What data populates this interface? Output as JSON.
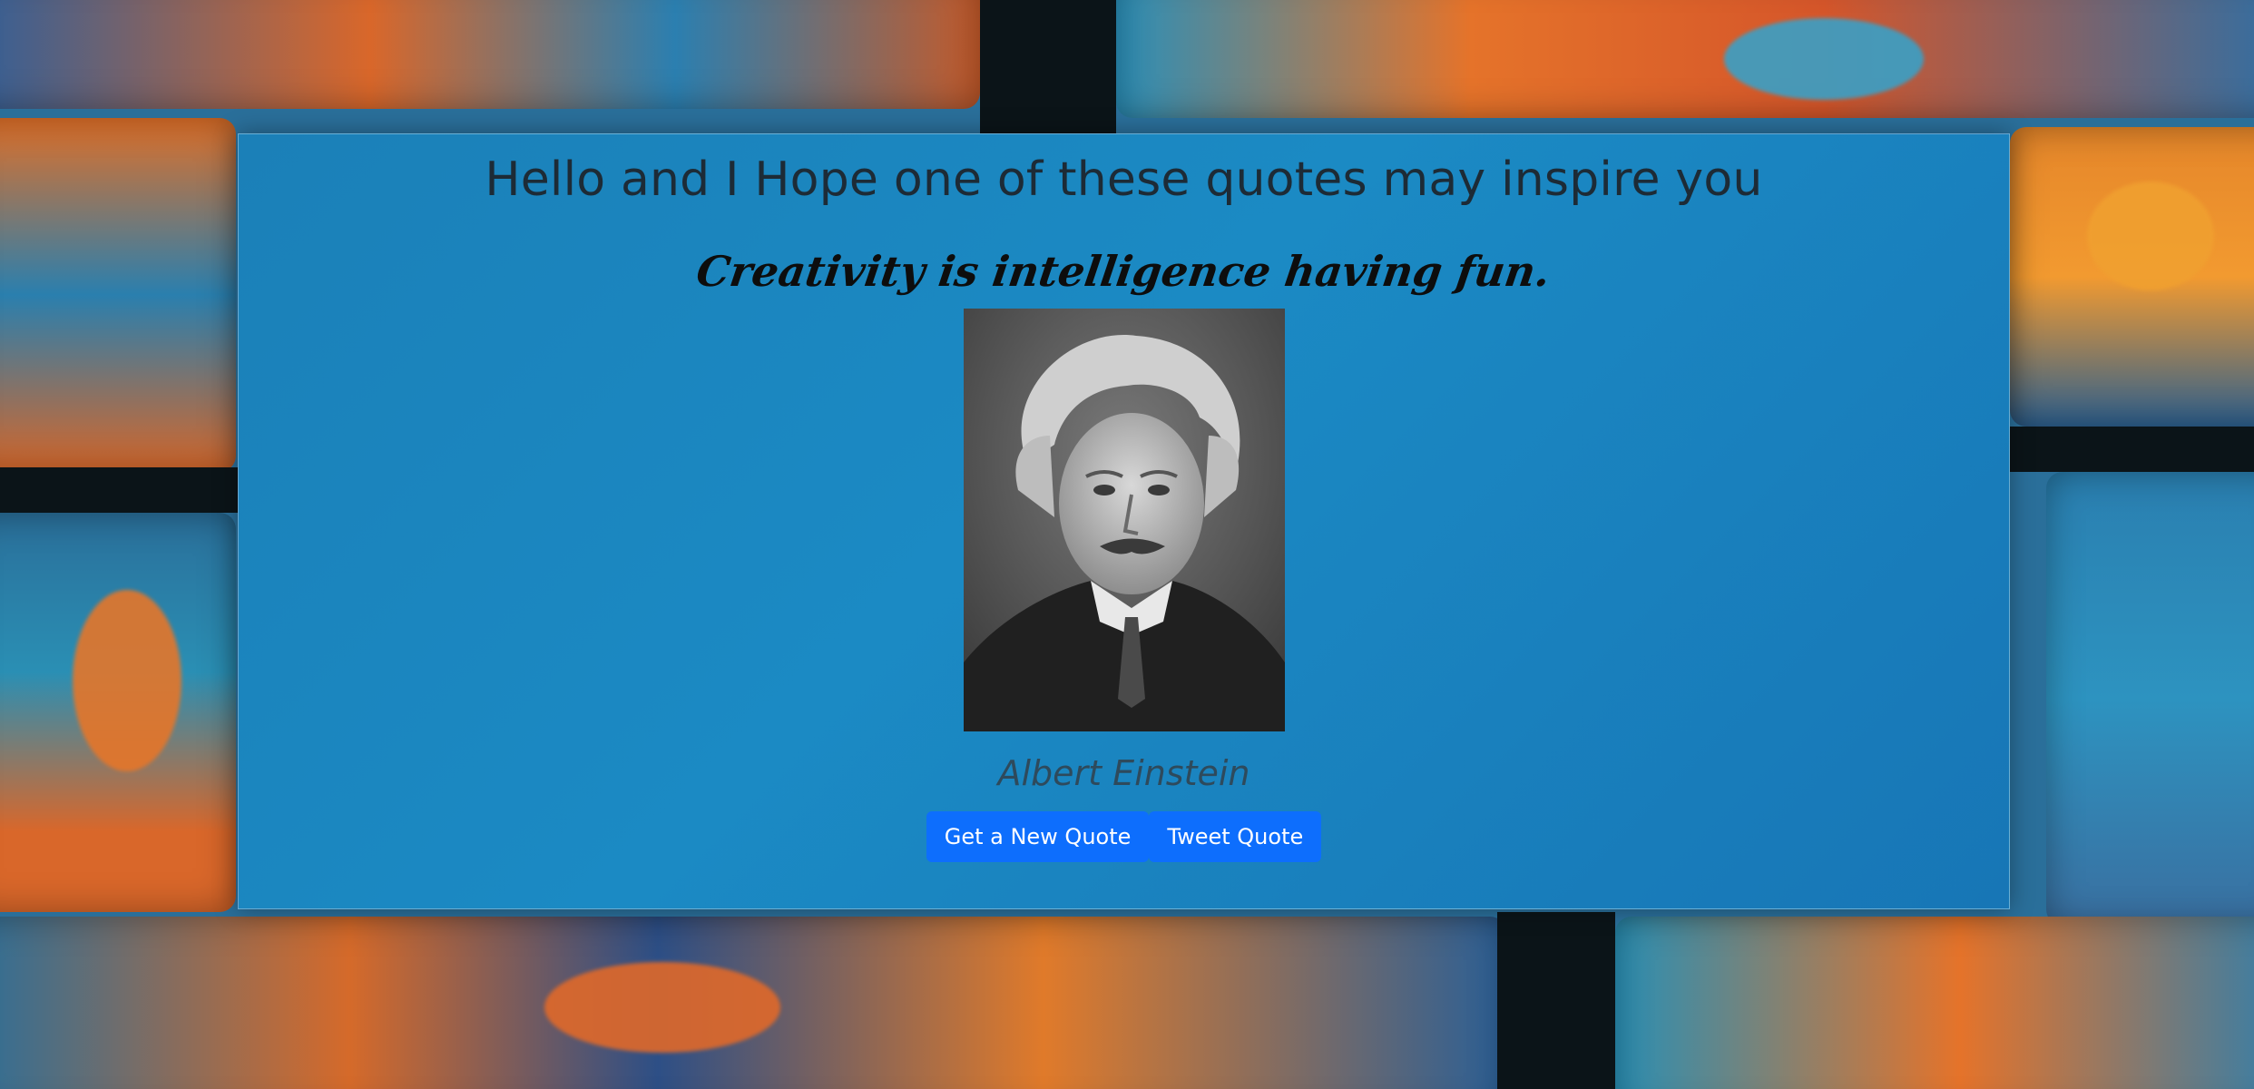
{
  "page": {
    "heading": "Hello and I Hope one of these quotes may inspire you"
  },
  "quote": {
    "text": "Creativity is intelligence having fun.",
    "author": "Albert Einstein",
    "image_alt": "Albert Einstein portrait"
  },
  "buttons": {
    "new_quote": "Get a New Quote",
    "tweet": "Tweet Quote"
  },
  "colors": {
    "card_background": "#1b8ac4",
    "button": "#0d6efd",
    "button_text": "#ffffff",
    "heading_text": "#1d2b36",
    "author_text": "#2e4a5c"
  }
}
